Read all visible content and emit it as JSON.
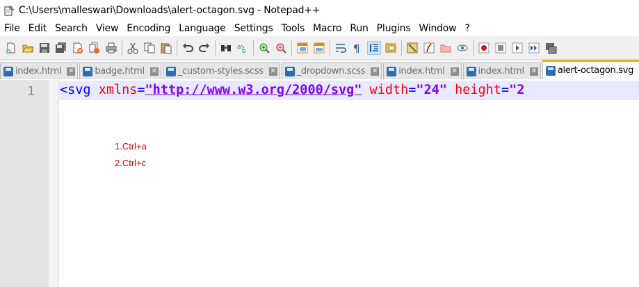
{
  "window": {
    "title": "C:\\Users\\malleswari\\Downloads\\alert-octagon.svg - Notepad++",
    "app_icon": "notepad-plus-plus-icon"
  },
  "menu": [
    "File",
    "Edit",
    "Search",
    "View",
    "Encoding",
    "Language",
    "Settings",
    "Tools",
    "Macro",
    "Run",
    "Plugins",
    "Window",
    "?"
  ],
  "toolbar": {
    "icons": [
      "new-file-icon",
      "open-file-icon",
      "save-icon",
      "save-all-icon",
      "close-icon",
      "close-all-icon",
      "print-icon",
      "cut-icon",
      "copy-icon",
      "paste-icon",
      "undo-icon",
      "redo-icon",
      "find-icon",
      "replace-icon",
      "zoom-in-icon",
      "zoom-out-icon",
      "sync-vertical-icon",
      "sync-horizontal-icon",
      "word-wrap-icon",
      "show-all-characters-icon",
      "indent-guide-icon",
      "doc-map-icon",
      "function-list-icon",
      "folder-as-workspace-icon",
      "monitoring-icon",
      "record-macro-icon",
      "stop-record-icon",
      "play-macro-icon",
      "run-macro-multiple-icon",
      "save-macro-icon"
    ]
  },
  "tabs": [
    {
      "label": "index.html",
      "active": false
    },
    {
      "label": "badge.html",
      "active": false
    },
    {
      "label": "_custom-styles.scss",
      "active": false
    },
    {
      "label": "_dropdown.scss",
      "active": false
    },
    {
      "label": "index.html",
      "active": false
    },
    {
      "label": "index.html",
      "active": false
    },
    {
      "label": "alert-octagon.svg",
      "active": true
    }
  ],
  "editor": {
    "line_number": "1",
    "code": {
      "open": "<svg ",
      "attr1": "xmlns",
      "eq1": "=",
      "val1": "\"http://www.w3.org/2000/svg\"",
      "attr2": " width",
      "eq2": "=",
      "val2": "\"24\"",
      "attr3": " height",
      "eq3": "=",
      "val3": "\"2"
    }
  },
  "annotations": [
    "1.Ctrl+a",
    "2.Ctrl+c"
  ],
  "colors": {
    "tag": "#0000ff",
    "attribute": "#ff0000",
    "value": "#8000ff",
    "annotation": "#e00000",
    "active_tab_accent": "#f9a825"
  }
}
